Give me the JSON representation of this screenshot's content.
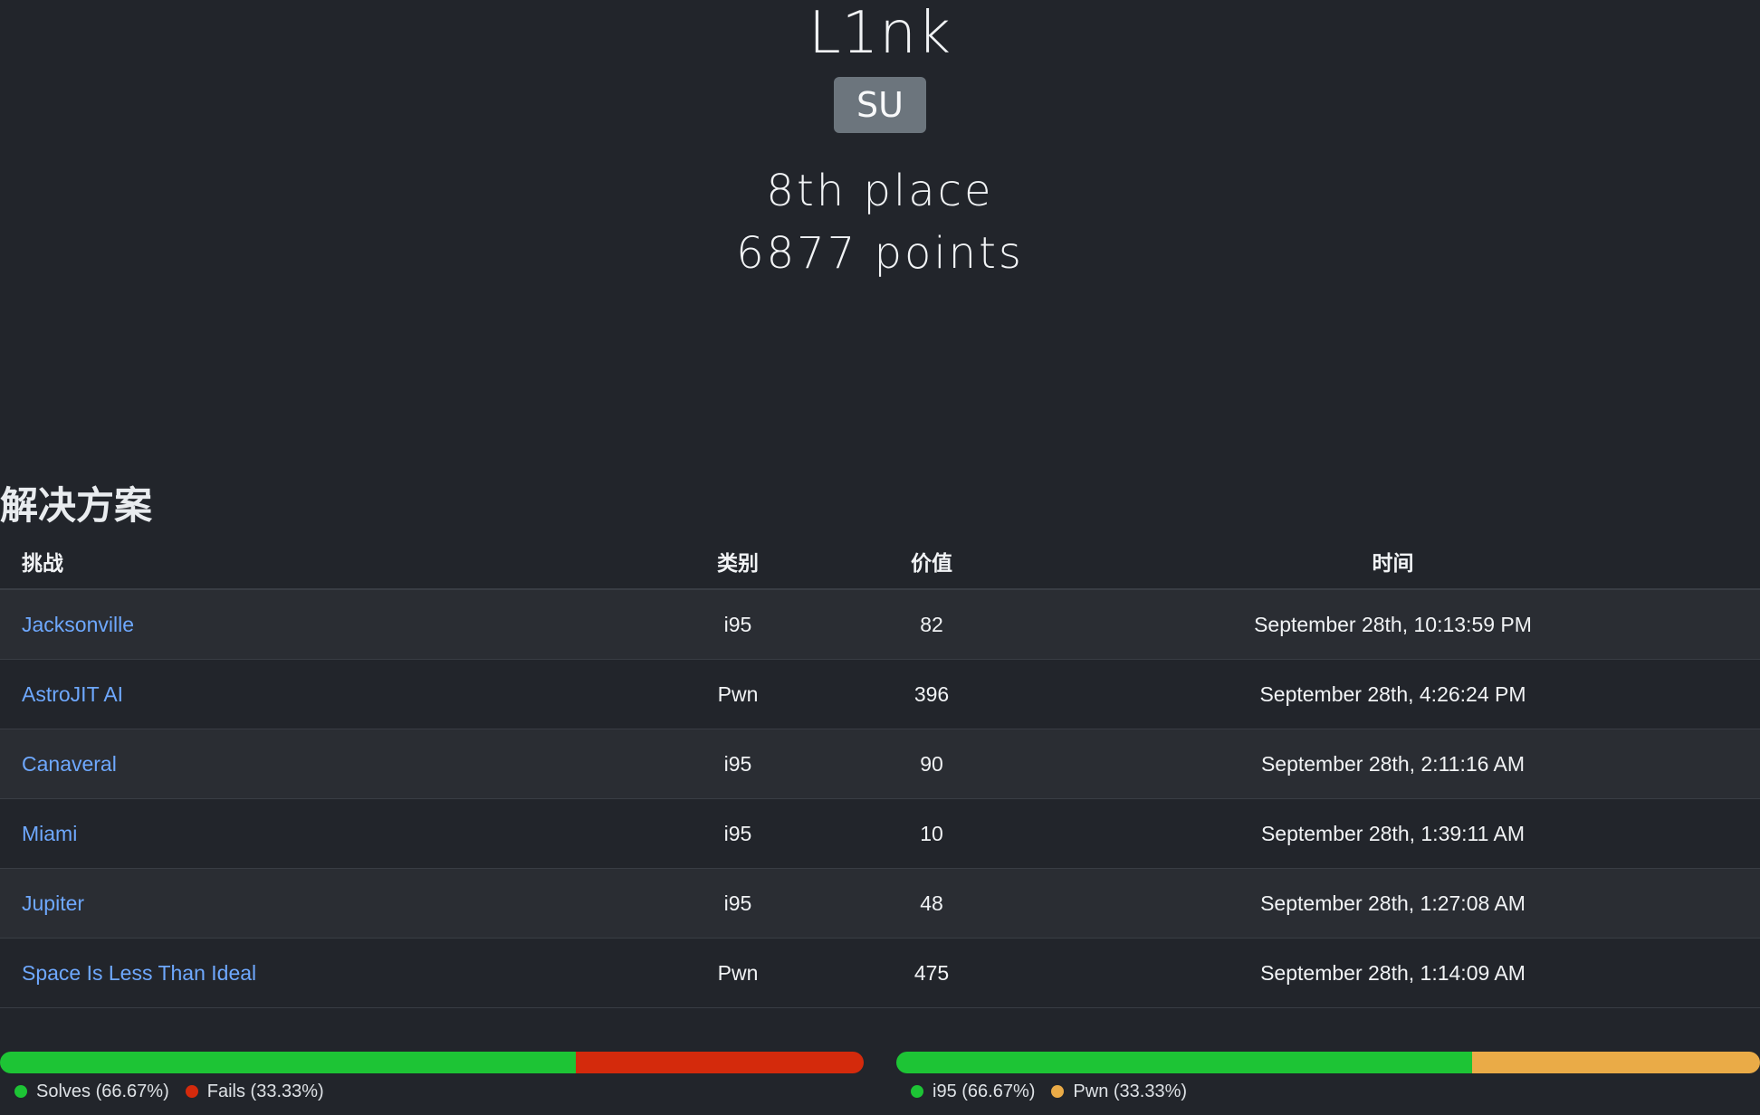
{
  "team": {
    "name": "L1nk",
    "affiliation": "SU",
    "place": "8th place",
    "points": "6877 points"
  },
  "solves": {
    "title": "解决方案",
    "columns": {
      "challenge": "挑战",
      "category": "类别",
      "value": "价值",
      "time": "时间"
    },
    "rows": [
      {
        "challenge": "Jacksonville",
        "category": "i95",
        "value": "82",
        "time": "September 28th, 10:13:59 PM"
      },
      {
        "challenge": "AstroJIT AI",
        "category": "Pwn",
        "value": "396",
        "time": "September 28th, 4:26:24 PM"
      },
      {
        "challenge": "Canaveral",
        "category": "i95",
        "value": "90",
        "time": "September 28th, 2:11:16 AM"
      },
      {
        "challenge": "Miami",
        "category": "i95",
        "value": "10",
        "time": "September 28th, 1:39:11 AM"
      },
      {
        "challenge": "Jupiter",
        "category": "i95",
        "value": "48",
        "time": "September 28th, 1:27:08 AM"
      },
      {
        "challenge": "Space Is Less Than Ideal",
        "category": "Pwn",
        "value": "475",
        "time": "September 28th, 1:14:09 AM"
      }
    ]
  },
  "stats": {
    "solve_breakdown": [
      {
        "label": "Solves (66.67%)",
        "fraction": 0.6667,
        "color": "#1dc435"
      },
      {
        "label": "Fails (33.33%)",
        "fraction": 0.3333,
        "color": "#d42a0c"
      }
    ],
    "category_breakdown": [
      {
        "label": "i95 (66.67%)",
        "fraction": 0.6667,
        "color": "#1dc435"
      },
      {
        "label": "Pwn (33.33%)",
        "fraction": 0.3333,
        "color": "#eaab47"
      }
    ]
  }
}
